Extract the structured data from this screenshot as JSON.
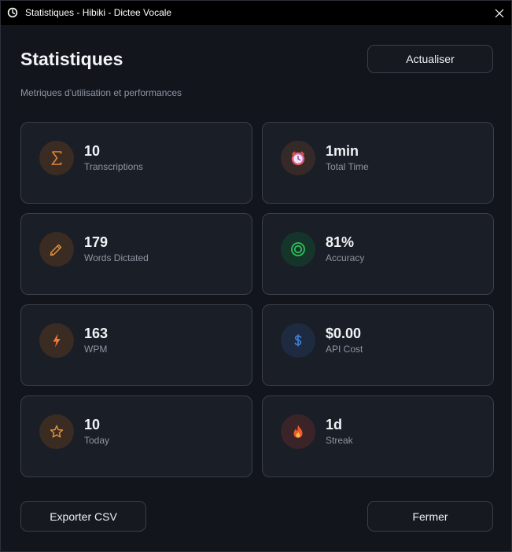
{
  "window": {
    "title": "Statistiques - Hibiki - Dictee Vocale"
  },
  "header": {
    "title": "Statistiques",
    "subtitle": "Metriques d'utilisation et performances",
    "refresh_label": "Actualiser"
  },
  "stats": [
    {
      "value": "10",
      "label": "Transcriptions",
      "icon": "sigma-icon",
      "color": "#e0863a",
      "bg": "#3a2c22"
    },
    {
      "value": "1min",
      "label": "Total Time",
      "icon": "alarm-clock-icon",
      "color": "#c46bd0",
      "bg": "#352a28"
    },
    {
      "value": "179",
      "label": "Words Dictated",
      "icon": "pencil-icon",
      "color": "#e8933a",
      "bg": "#3a2c22"
    },
    {
      "value": "81%",
      "label": "Accuracy",
      "icon": "target-icon",
      "color": "#2ec05a",
      "bg": "#16352a"
    },
    {
      "value": "163",
      "label": "WPM",
      "icon": "lightning-icon",
      "color": "#f07a3a",
      "bg": "#3a2c22"
    },
    {
      "value": "$0.00",
      "label": "API Cost",
      "icon": "dollar-icon",
      "color": "#3f86e0",
      "bg": "#1d2a40"
    },
    {
      "value": "10",
      "label": "Today",
      "icon": "star-icon",
      "color": "#e8933a",
      "bg": "#3a2c22"
    },
    {
      "value": "1d",
      "label": "Streak",
      "icon": "flame-icon",
      "color": "#f05a2a",
      "bg": "#3a2428"
    }
  ],
  "footer": {
    "export_label": "Exporter CSV",
    "close_label": "Fermer"
  }
}
